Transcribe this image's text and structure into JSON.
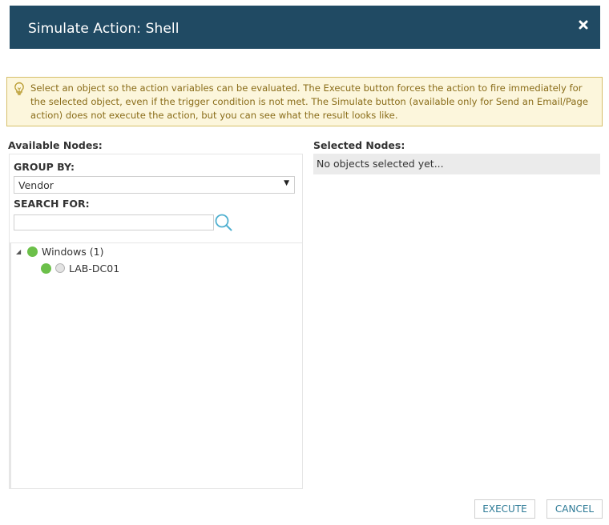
{
  "dialog": {
    "title": "Simulate Action: Shell",
    "close_icon": "close-icon"
  },
  "hint": {
    "icon": "lightbulb-icon",
    "text": "Select an object so the action variables can be evaluated. The Execute button forces the action to fire immediately for the selected object, even if the trigger condition is not met. The Simulate button (available only for Send an Email/Page action) does not execute the action, but you can see what the result looks like."
  },
  "available": {
    "label": "Available Nodes:",
    "group_by_label": "GROUP BY:",
    "group_by_value": "Vendor",
    "search_label": "SEARCH FOR:",
    "search_value": "",
    "search_placeholder": "",
    "tree": [
      {
        "label": "Windows (1)",
        "status": "up",
        "expanded": true,
        "children": [
          {
            "label": "LAB-DC01",
            "status": "up",
            "selected": false
          }
        ]
      }
    ]
  },
  "selected": {
    "label": "Selected Nodes:",
    "empty_text": "No objects selected yet..."
  },
  "buttons": {
    "execute": "EXECUTE",
    "cancel": "CANCEL"
  },
  "colors": {
    "titlebar": "#204a63",
    "status_up": "#6cc04a",
    "hint_bg": "#fcf6dc",
    "hint_text": "#8a6d1a",
    "button_text": "#2d7a96"
  }
}
